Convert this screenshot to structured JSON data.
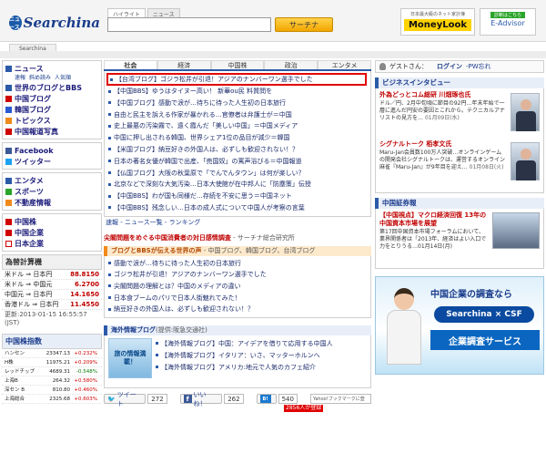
{
  "header": {
    "logo": "Searchina",
    "logo_mark": "ニュース",
    "search_tabs": [
      "ハイライト",
      "ニュース"
    ],
    "search_button": "サーチナ",
    "site_tab": "Searchina",
    "ad_moneylook_small": "日本最大級のネット家計簿",
    "ad_moneylook_big": "MoneyLook",
    "ad_eadvisor_tag": "診断はこちら",
    "ad_eadvisor_name": "E-Advisor"
  },
  "left_nav": {
    "news": "ニュース",
    "news_sub": [
      "速報",
      "斜め読み",
      "人気順"
    ],
    "items1": [
      "世界のブログとBBS",
      "中国ブログ",
      "韓国ブログ",
      "トピックス",
      "中国報道写真"
    ],
    "social": [
      "Facebook",
      "ツイッター"
    ],
    "items2": [
      "エンタメ",
      "スポーツ",
      "不動産情報"
    ],
    "items3": [
      "中国株",
      "中国企業",
      "日本企業"
    ]
  },
  "fx": {
    "title": "為替計算機",
    "rows": [
      {
        "pair": "米ドル ⇒ 日本円",
        "value": "88.8150"
      },
      {
        "pair": "米ドル ⇒ 中国元",
        "value": "6.2700"
      },
      {
        "pair": "中国元 ⇒ 日本円",
        "value": "14.1650"
      },
      {
        "pair": "香港ドル ⇒ 日本円",
        "value": "11.4550"
      }
    ],
    "updated": "更新:2013-01-15 16:55:57",
    "timezone": "(JST)"
  },
  "index": {
    "title": "中国株指数",
    "rows": [
      {
        "name": "ハンセン",
        "value": "23347.13",
        "change": "+0.232%",
        "dir": "up"
      },
      {
        "name": "H株",
        "value": "11975.21",
        "change": "+0.209%",
        "dir": "up"
      },
      {
        "name": "レッドチップ",
        "value": "4689.31",
        "change": "-0.548%",
        "dir": "dn"
      },
      {
        "name": "上海B",
        "value": "264.32",
        "change": "+0.580%",
        "dir": "up"
      },
      {
        "name": "深セン B",
        "value": "810.80",
        "change": "+0.460%",
        "dir": "up"
      },
      {
        "name": "上海総合",
        "value": "2325.68",
        "change": "+0.603%",
        "dir": "up"
      }
    ]
  },
  "center": {
    "tabs": [
      "社会",
      "経済",
      "中国株",
      "政治",
      "エンタメ"
    ],
    "news": [
      "【台湾ブログ】ゴジラ松井が引退！アジアのナンバーワン選手でした",
      "【中国BBS】ゆうはタイヌー高い！ 新華ou民 料質問を",
      "【中国ブログ】感動で涙が…待ちに待った人生初の日本旅行",
      "自由と民主を訴える作家が暴かれる…官僚者は弁護士が＝中国",
      "史上最悪の汚染霧で、遠く霞んだ「美しい中国」＝中国メディア",
      "中国に押し出される韓国、世界シェア1位の品目が減少＝韓国",
      "【米国ブログ】納豆好きの外国人は、必ずしも歓迎されない！？",
      "日本の著名女優が韓国で出産、「売国奴」の罵声浴びる＝中国報道",
      "【仏国ブログ】大阪の秋葉原で「でんでんタウン」は何が楽しい？",
      "北京などで深刻な大気汚染…日本大使館が在中邦人に「防塵策」伝授",
      "【中国BBS】わが国も同様だ…存続を不安に思う＝中国ネット",
      "【中国BBS】残念しい…日本の成人式について中国人が考察の言葉"
    ],
    "links": "速報 - ニュース一覧 - ランキング",
    "survey_title": "尖閣問題をめぐる中国消費者の対日感情調査",
    "survey_src": " - サーチナ総合研究所",
    "blog_header": "ブログとBBSが伝える世界の声",
    "blog_header_sub": " - 中国ブログ、韓国ブログ、台湾ブログ",
    "blogs": [
      "感動で涙が…待ちに待った人生初の日本旅行",
      "ゴジラ松井が引退！アジアのナンバーワン選手でした",
      "尖閣問題の理解とは？中国のメディアの違い",
      "日本食ブームのパリで日本人街魅れてみた！",
      "納豆好きの外国人は、必ずしも歓迎されない！？"
    ],
    "kaigai_header": "海外情報ブログ",
    "kaigai_header_sub": "(提供:阪急交通社)",
    "tabi_label": "旅の情報満載！",
    "kaigai": [
      "【海外情報ブログ】中国：アイデアを借りて応用する中国人",
      "【海外情報ブログ】イタリア：いさ、マッターホルンへ",
      "【海外情報ブログ】アメリカ:地元で人気のカフェ紹介"
    ],
    "share": {
      "tweet": "ツイート",
      "tweet_count": "272",
      "fb_like": "いいね！",
      "fb_count": "262",
      "hatena": "B!",
      "hatena_count": "540",
      "yahoo": "Yahoo!ブックマークに登録",
      "users": "2856人が登録"
    }
  },
  "right": {
    "guest": "ゲストさん：",
    "login": "ログイン",
    "pw": "-PW忘れ",
    "interview_head": "ビジネスインタビュー",
    "interviews": [
      {
        "title": "外為どっとコム総研 川畑琢也氏",
        "body": "ドル／円、2月中旬頃に節目の92円…年末年始で一層に進んだ円安の要因とこれから。テクニカルアナリストの見方を…",
        "date": "01月09日(水)"
      },
      {
        "title": "シグナルトーク 栢孝文氏",
        "body": "Maru-Jan会員数100万人突破…オンラインゲームの開発会社シグナルトークは、運営するオンライン麻雀『Maru-Jan』が9年目を迎え…",
        "date": "01月08日(火)"
      }
    ],
    "security_head": "中国証券報",
    "security": {
      "title": "【中国視点】マクロ経済回復 13年の中国資本市場を展望",
      "body": "第17回中国資本市場フォーラムにおいて、業界関係者は「2013年、経済はよい入口で力をとりうる…01月14日(月)"
    },
    "banner_title": "中国企業の調査なら",
    "banner_logo": "Searchina × CSF",
    "banner_sub": "企業調査サービス"
  },
  "colors": {
    "accent_blue": "#2b5aa8",
    "highlight_red": "#e00000",
    "search_orange": "#f2a600"
  }
}
